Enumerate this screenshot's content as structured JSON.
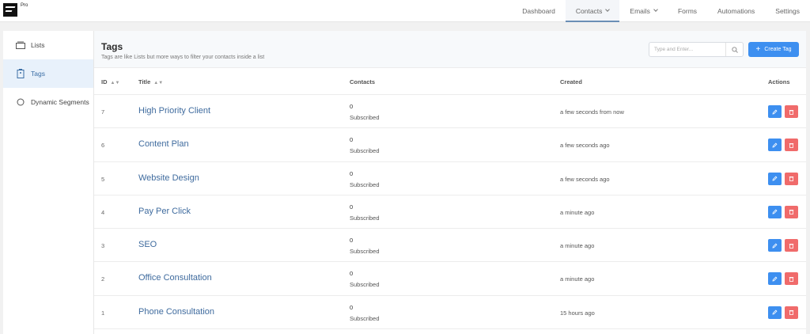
{
  "app": {
    "badge": "Pro"
  },
  "nav": {
    "items": [
      {
        "label": "Dashboard"
      },
      {
        "label": "Contacts"
      },
      {
        "label": "Emails"
      },
      {
        "label": "Forms"
      },
      {
        "label": "Automations"
      },
      {
        "label": "Settings"
      }
    ],
    "active": "Contacts"
  },
  "sidebar": {
    "items": [
      {
        "label": "Lists",
        "icon": "folder-icon"
      },
      {
        "label": "Tags",
        "icon": "tag-icon"
      },
      {
        "label": "Dynamic Segments",
        "icon": "segment-icon"
      }
    ],
    "active": "Tags"
  },
  "header": {
    "title": "Tags",
    "subtitle": "Tags are like Lists but more ways to filter your contacts inside a list",
    "search_placeholder": "Type and Enter...",
    "create_label": "Create Tag"
  },
  "table": {
    "columns": {
      "id": "ID",
      "title": "Title",
      "contacts": "Contacts",
      "created": "Created",
      "actions": "Actions"
    },
    "rows": [
      {
        "id": "7",
        "title": "High Priority Client",
        "count": "0",
        "status": "Subscribed",
        "created": "a few seconds from now"
      },
      {
        "id": "6",
        "title": "Content Plan",
        "count": "0",
        "status": "Subscribed",
        "created": "a few seconds ago"
      },
      {
        "id": "5",
        "title": "Website Design",
        "count": "0",
        "status": "Subscribed",
        "created": "a few seconds ago"
      },
      {
        "id": "4",
        "title": "Pay Per Click",
        "count": "0",
        "status": "Subscribed",
        "created": "a minute ago"
      },
      {
        "id": "3",
        "title": "SEO",
        "count": "0",
        "status": "Subscribed",
        "created": "a minute ago"
      },
      {
        "id": "2",
        "title": "Office Consultation",
        "count": "0",
        "status": "Subscribed",
        "created": "a minute ago"
      },
      {
        "id": "1",
        "title": "Phone Consultation",
        "count": "0",
        "status": "Subscribed",
        "created": "15 hours ago"
      }
    ]
  },
  "colors": {
    "primary": "#3d8ff0",
    "danger": "#f06b6b",
    "link": "#3f6b9e",
    "active_bg": "#e8f1fb"
  }
}
